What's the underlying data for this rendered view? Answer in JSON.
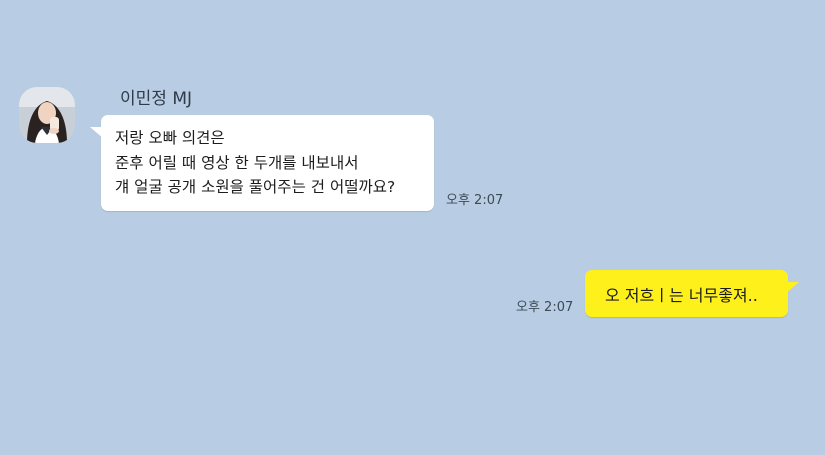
{
  "chat": {
    "background_color": "#b8cde3",
    "incoming": {
      "sender_name": "이민정 MJ",
      "avatar_icon": "profile-photo",
      "lines": [
        "저랑 오빠 의견은",
        "준후 어릴 때 영상 한 두개를 내보내서",
        "걔 얼굴 공개 소원을 풀어주는 건 어떨까요?"
      ],
      "time": "오후 2:07",
      "bubble_color": "#ffffff"
    },
    "outgoing": {
      "text": "오 저흐ㅣ는 너무좋져..",
      "time": "오후 2:07",
      "bubble_color": "#fef01b"
    }
  }
}
